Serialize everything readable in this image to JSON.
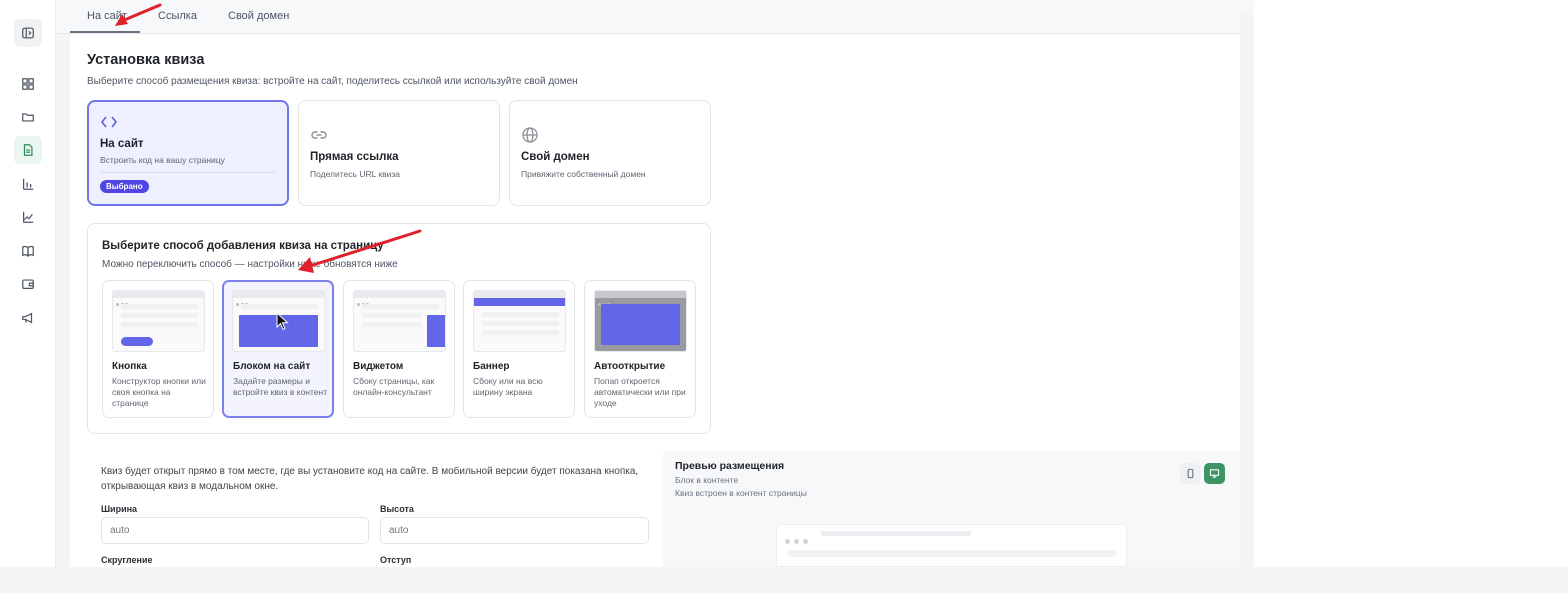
{
  "tabs": [
    {
      "label": "На сайт"
    },
    {
      "label": "Ссылка"
    },
    {
      "label": "Свой домен"
    }
  ],
  "section": {
    "title": "Установка квиза",
    "subtitle": "Выберите способ размещения квиза: встройте на сайт, поделитесь ссылкой или используйте свой домен"
  },
  "options": [
    {
      "title": "На сайт",
      "desc": "Встроить код на вашу страницу",
      "badge": "Выбрано",
      "icon": "code-icon"
    },
    {
      "title": "Прямая ссылка",
      "desc": "Поделитесь URL квиза",
      "icon": "link-icon"
    },
    {
      "title": "Свой домен",
      "desc": "Привяжите собственный домен",
      "icon": "globe-icon"
    }
  ],
  "method": {
    "title": "Выберите способ добавления квиза на страницу",
    "subtitle": "Можно переключить способ — настройки ниже обновятся ниже",
    "cards": [
      {
        "title": "Кнопка",
        "desc": "Конструктор кнопки или своя кнопка на странице"
      },
      {
        "title": "Блоком на сайт",
        "desc": "Задайте размеры и встройте квиз в контент"
      },
      {
        "title": "Виджетом",
        "desc": "Сбоку страницы, как онлайн-консультант"
      },
      {
        "title": "Баннер",
        "desc": "Сбоку или на всю ширину экрана"
      },
      {
        "title": "Автооткрытие",
        "desc": "Попап откроется автоматически или при уходе"
      }
    ]
  },
  "info": {
    "text": "Квиз будет открыт прямо в том месте, где вы установите код на сайте. В мобильной версии будет показана кнопка, открывающая квиз в модальном окне."
  },
  "fields": {
    "width_label": "Ширина",
    "width_placeholder": "auto",
    "height_label": "Высота",
    "height_placeholder": "auto",
    "radius_label": "Скругление",
    "offset_label": "Отступ"
  },
  "preview": {
    "title": "Превью размещения",
    "subtitle1": "Блок в контенте",
    "subtitle2": "Квиз встроен в контент страницы"
  },
  "colors": {
    "accent": "#5b5fe0",
    "badge": "#4f46e5",
    "thumb_fill": "#6366e8",
    "green": "#3c9467",
    "arrow": "#e0202a"
  }
}
